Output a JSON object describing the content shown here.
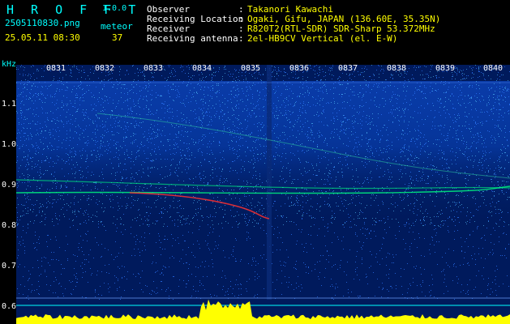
{
  "header": {
    "brand": "H R O F F T",
    "version": "1.0.0",
    "filename": "2505110830.png",
    "meteor_label": "meteor",
    "datetime": "25.05.11 08:30",
    "meteor_count": "37"
  },
  "info": {
    "observer_label": "Observer",
    "observer_value": "Takanori Kawachi",
    "location_label": "Receiving Location",
    "location_value": "Ogaki, Gifu, JAPAN (136.60E, 35.35N)",
    "receiver_label": "Receiver",
    "receiver_value": "R820T2(RTL-SDR) SDR-Sharp 53.372MHz",
    "antenna_label": "Receiving antenna",
    "antenna_value": "2el-HB9CV Vertical (el. E-W)",
    "colon": ":"
  },
  "axis": {
    "y_unit": "kHz",
    "y_ticks": [
      "1.1",
      "1.0",
      "0.9",
      "0.8",
      "0.7",
      "0.6"
    ],
    "x_ticks": [
      "0831",
      "0832",
      "0833",
      "0834",
      "0835",
      "0836",
      "0837",
      "0838",
      "0839",
      "0840"
    ]
  },
  "colors": {
    "background": "#000000",
    "label": "#00ffff",
    "value": "#ffff00",
    "text": "#ffffff",
    "noise_floor": "#001a5c",
    "signal": "#00ff80",
    "strong_signal": "#ff3030",
    "level_bar": "#ffff00",
    "marker": "#00ffff"
  }
}
